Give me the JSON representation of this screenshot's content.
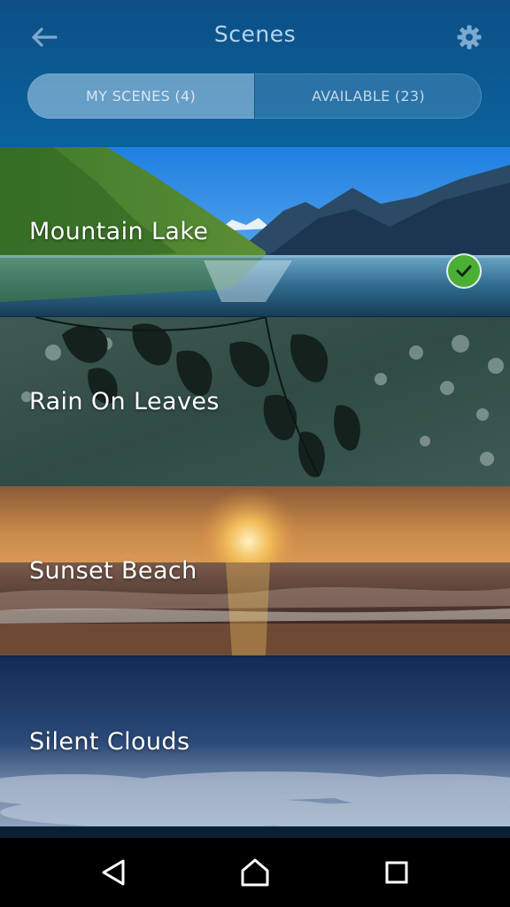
{
  "header": {
    "title": "Scenes",
    "back_icon": "arrow-left-icon",
    "settings_icon": "gear-icon"
  },
  "tabs": [
    {
      "label": "MY SCENES (4)",
      "active": true
    },
    {
      "label": "AVAILABLE (23)",
      "active": false
    }
  ],
  "scenes": [
    {
      "name": "Mountain Lake",
      "selected": true
    },
    {
      "name": "Rain On Leaves",
      "selected": false
    },
    {
      "name": "Sunset Beach",
      "selected": false
    },
    {
      "name": "Silent Clouds",
      "selected": false
    }
  ],
  "navbar": {
    "back_icon": "nav-back-icon",
    "home_icon": "nav-home-icon",
    "recents_icon": "nav-recents-icon"
  },
  "colors": {
    "header_bg": "#0b5a93",
    "check_green": "#4caf35",
    "title_text": "#b9d3ea"
  }
}
